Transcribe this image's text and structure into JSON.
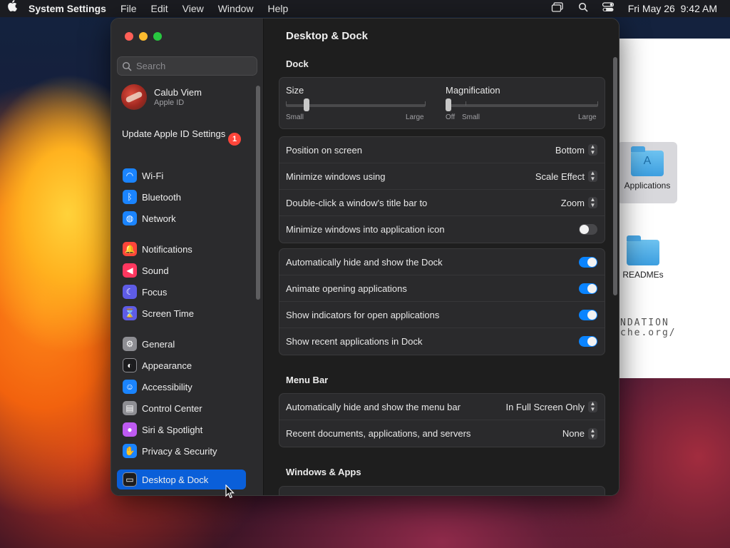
{
  "menubar": {
    "app": "System Settings",
    "items": [
      "File",
      "Edit",
      "View",
      "Window",
      "Help"
    ],
    "clock": "Fri May 26  9:42 AM"
  },
  "finder": {
    "items": [
      {
        "label": "Applications"
      },
      {
        "label": "READMEs"
      }
    ],
    "fragment_line1": "NDATION",
    "fragment_line2": "che.org/"
  },
  "sidebar": {
    "search_placeholder": "Search",
    "profile": {
      "name": "Calub Viem",
      "sub": "Apple ID"
    },
    "update": {
      "label": "Update Apple ID Settings",
      "badge": "1"
    },
    "items": [
      {
        "label": "Wi-Fi",
        "icon": "wifi-icon",
        "color": "#1a84ff"
      },
      {
        "label": "Bluetooth",
        "icon": "bluetooth-icon",
        "color": "#1a84ff"
      },
      {
        "label": "Network",
        "icon": "globe-icon",
        "color": "#1a84ff"
      },
      {
        "label": "Notifications",
        "icon": "bell-icon",
        "color": "#ff453a"
      },
      {
        "label": "Sound",
        "icon": "speaker-icon",
        "color": "#ff375f"
      },
      {
        "label": "Focus",
        "icon": "moon-icon",
        "color": "#5e5ce6"
      },
      {
        "label": "Screen Time",
        "icon": "hourglass-icon",
        "color": "#5e5ce6"
      },
      {
        "label": "General",
        "icon": "gear-icon",
        "color": "#8e8e93"
      },
      {
        "label": "Appearance",
        "icon": "appearance-icon",
        "color": "#1c1c1e"
      },
      {
        "label": "Accessibility",
        "icon": "accessibility-icon",
        "color": "#1a84ff"
      },
      {
        "label": "Control Center",
        "icon": "control-center-icon",
        "color": "#8e8e93"
      },
      {
        "label": "Siri & Spotlight",
        "icon": "siri-icon",
        "color": "#bf5af2"
      },
      {
        "label": "Privacy & Security",
        "icon": "hand-icon",
        "color": "#1a84ff"
      },
      {
        "label": "Desktop & Dock",
        "icon": "dock-icon",
        "color": "#1c1c1e"
      }
    ]
  },
  "content": {
    "title": "Desktop & Dock",
    "dock_section": "Dock",
    "size": {
      "title": "Size",
      "min": "Small",
      "max": "Large",
      "value": 0.15
    },
    "magnification": {
      "title": "Magnification",
      "off": "Off",
      "min": "Small",
      "max": "Large",
      "value": 0.0
    },
    "dock_rows": [
      {
        "label": "Position on screen",
        "value": "Bottom"
      },
      {
        "label": "Minimize windows using",
        "value": "Scale Effect"
      },
      {
        "label": "Double-click a window's title bar to",
        "value": "Zoom"
      },
      {
        "label": "Minimize windows into application icon",
        "toggle": false
      }
    ],
    "dock_toggles": [
      {
        "label": "Automatically hide and show the Dock",
        "toggle": true
      },
      {
        "label": "Animate opening applications",
        "toggle": true
      },
      {
        "label": "Show indicators for open applications",
        "toggle": true
      },
      {
        "label": "Show recent applications in Dock",
        "toggle": true
      }
    ],
    "menubar_section": "Menu Bar",
    "menubar_rows": [
      {
        "label": "Automatically hide and show the menu bar",
        "value": "In Full Screen Only"
      },
      {
        "label": "Recent documents, applications, and servers",
        "value": "None"
      }
    ],
    "windows_section": "Windows & Apps"
  },
  "colors": {
    "accent": "#0a84ff",
    "active_sidebar": "#0a5fd9"
  }
}
